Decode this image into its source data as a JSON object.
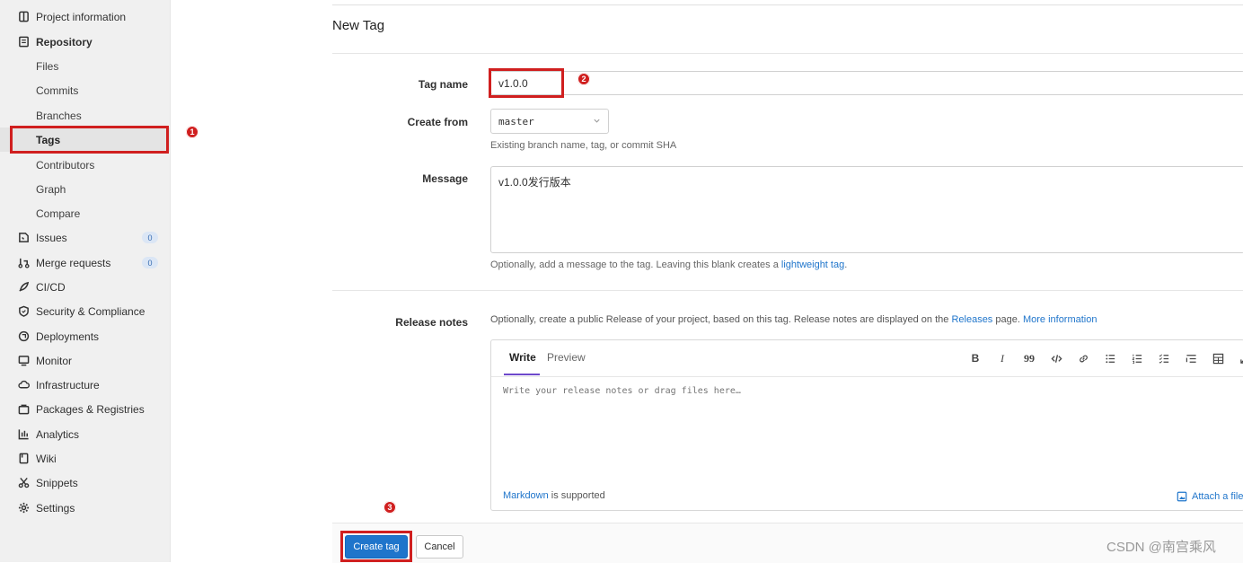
{
  "sidebar": {
    "items": [
      {
        "label": "Project information",
        "icon": "project-icon"
      },
      {
        "label": "Repository",
        "icon": "repository-icon"
      },
      {
        "label": "Files"
      },
      {
        "label": "Commits"
      },
      {
        "label": "Branches"
      },
      {
        "label": "Tags"
      },
      {
        "label": "Contributors"
      },
      {
        "label": "Graph"
      },
      {
        "label": "Compare"
      },
      {
        "label": "Issues",
        "icon": "issues-icon",
        "badge": "0"
      },
      {
        "label": "Merge requests",
        "icon": "merge-request-icon",
        "badge": "0"
      },
      {
        "label": "CI/CD",
        "icon": "rocket-icon"
      },
      {
        "label": "Security & Compliance",
        "icon": "shield-icon"
      },
      {
        "label": "Deployments",
        "icon": "deployments-icon"
      },
      {
        "label": "Monitor",
        "icon": "monitor-icon"
      },
      {
        "label": "Infrastructure",
        "icon": "cloud-icon"
      },
      {
        "label": "Packages & Registries",
        "icon": "package-icon"
      },
      {
        "label": "Analytics",
        "icon": "chart-icon"
      },
      {
        "label": "Wiki",
        "icon": "book-icon"
      },
      {
        "label": "Snippets",
        "icon": "scissors-icon"
      },
      {
        "label": "Settings",
        "icon": "gear-icon"
      }
    ]
  },
  "annotations": {
    "step1": "1",
    "step2": "2",
    "step3": "3"
  },
  "form": {
    "title": "New Tag",
    "tag_name_label": "Tag name",
    "tag_name_value": "v1.0.0",
    "create_from_label": "Create from",
    "create_from_value": "master",
    "create_from_help": "Existing branch name, tag, or commit SHA",
    "message_label": "Message",
    "message_value": "v1.0.0发行版本",
    "message_help_prefix": "Optionally, add a message to the tag. Leaving this blank creates a ",
    "message_help_link": "lightweight tag",
    "message_help_suffix": ".",
    "release_notes_label": "Release notes",
    "release_help_prefix": "Optionally, create a public Release of your project, based on this tag. Release notes are displayed on the ",
    "release_help_link": "Releases",
    "release_help_mid": " page. ",
    "release_help_more": "More information"
  },
  "editor": {
    "tab_write": "Write",
    "tab_preview": "Preview",
    "placeholder": "Write your release notes or drag files here…",
    "markdown_link": "Markdown",
    "markdown_suffix": " is supported",
    "attach_label": "Attach a file",
    "toolbar": {
      "bold": "B",
      "italic": "I",
      "quote": "99"
    }
  },
  "actions": {
    "create": "Create tag",
    "cancel": "Cancel"
  },
  "watermark": "CSDN @南宫乘风"
}
